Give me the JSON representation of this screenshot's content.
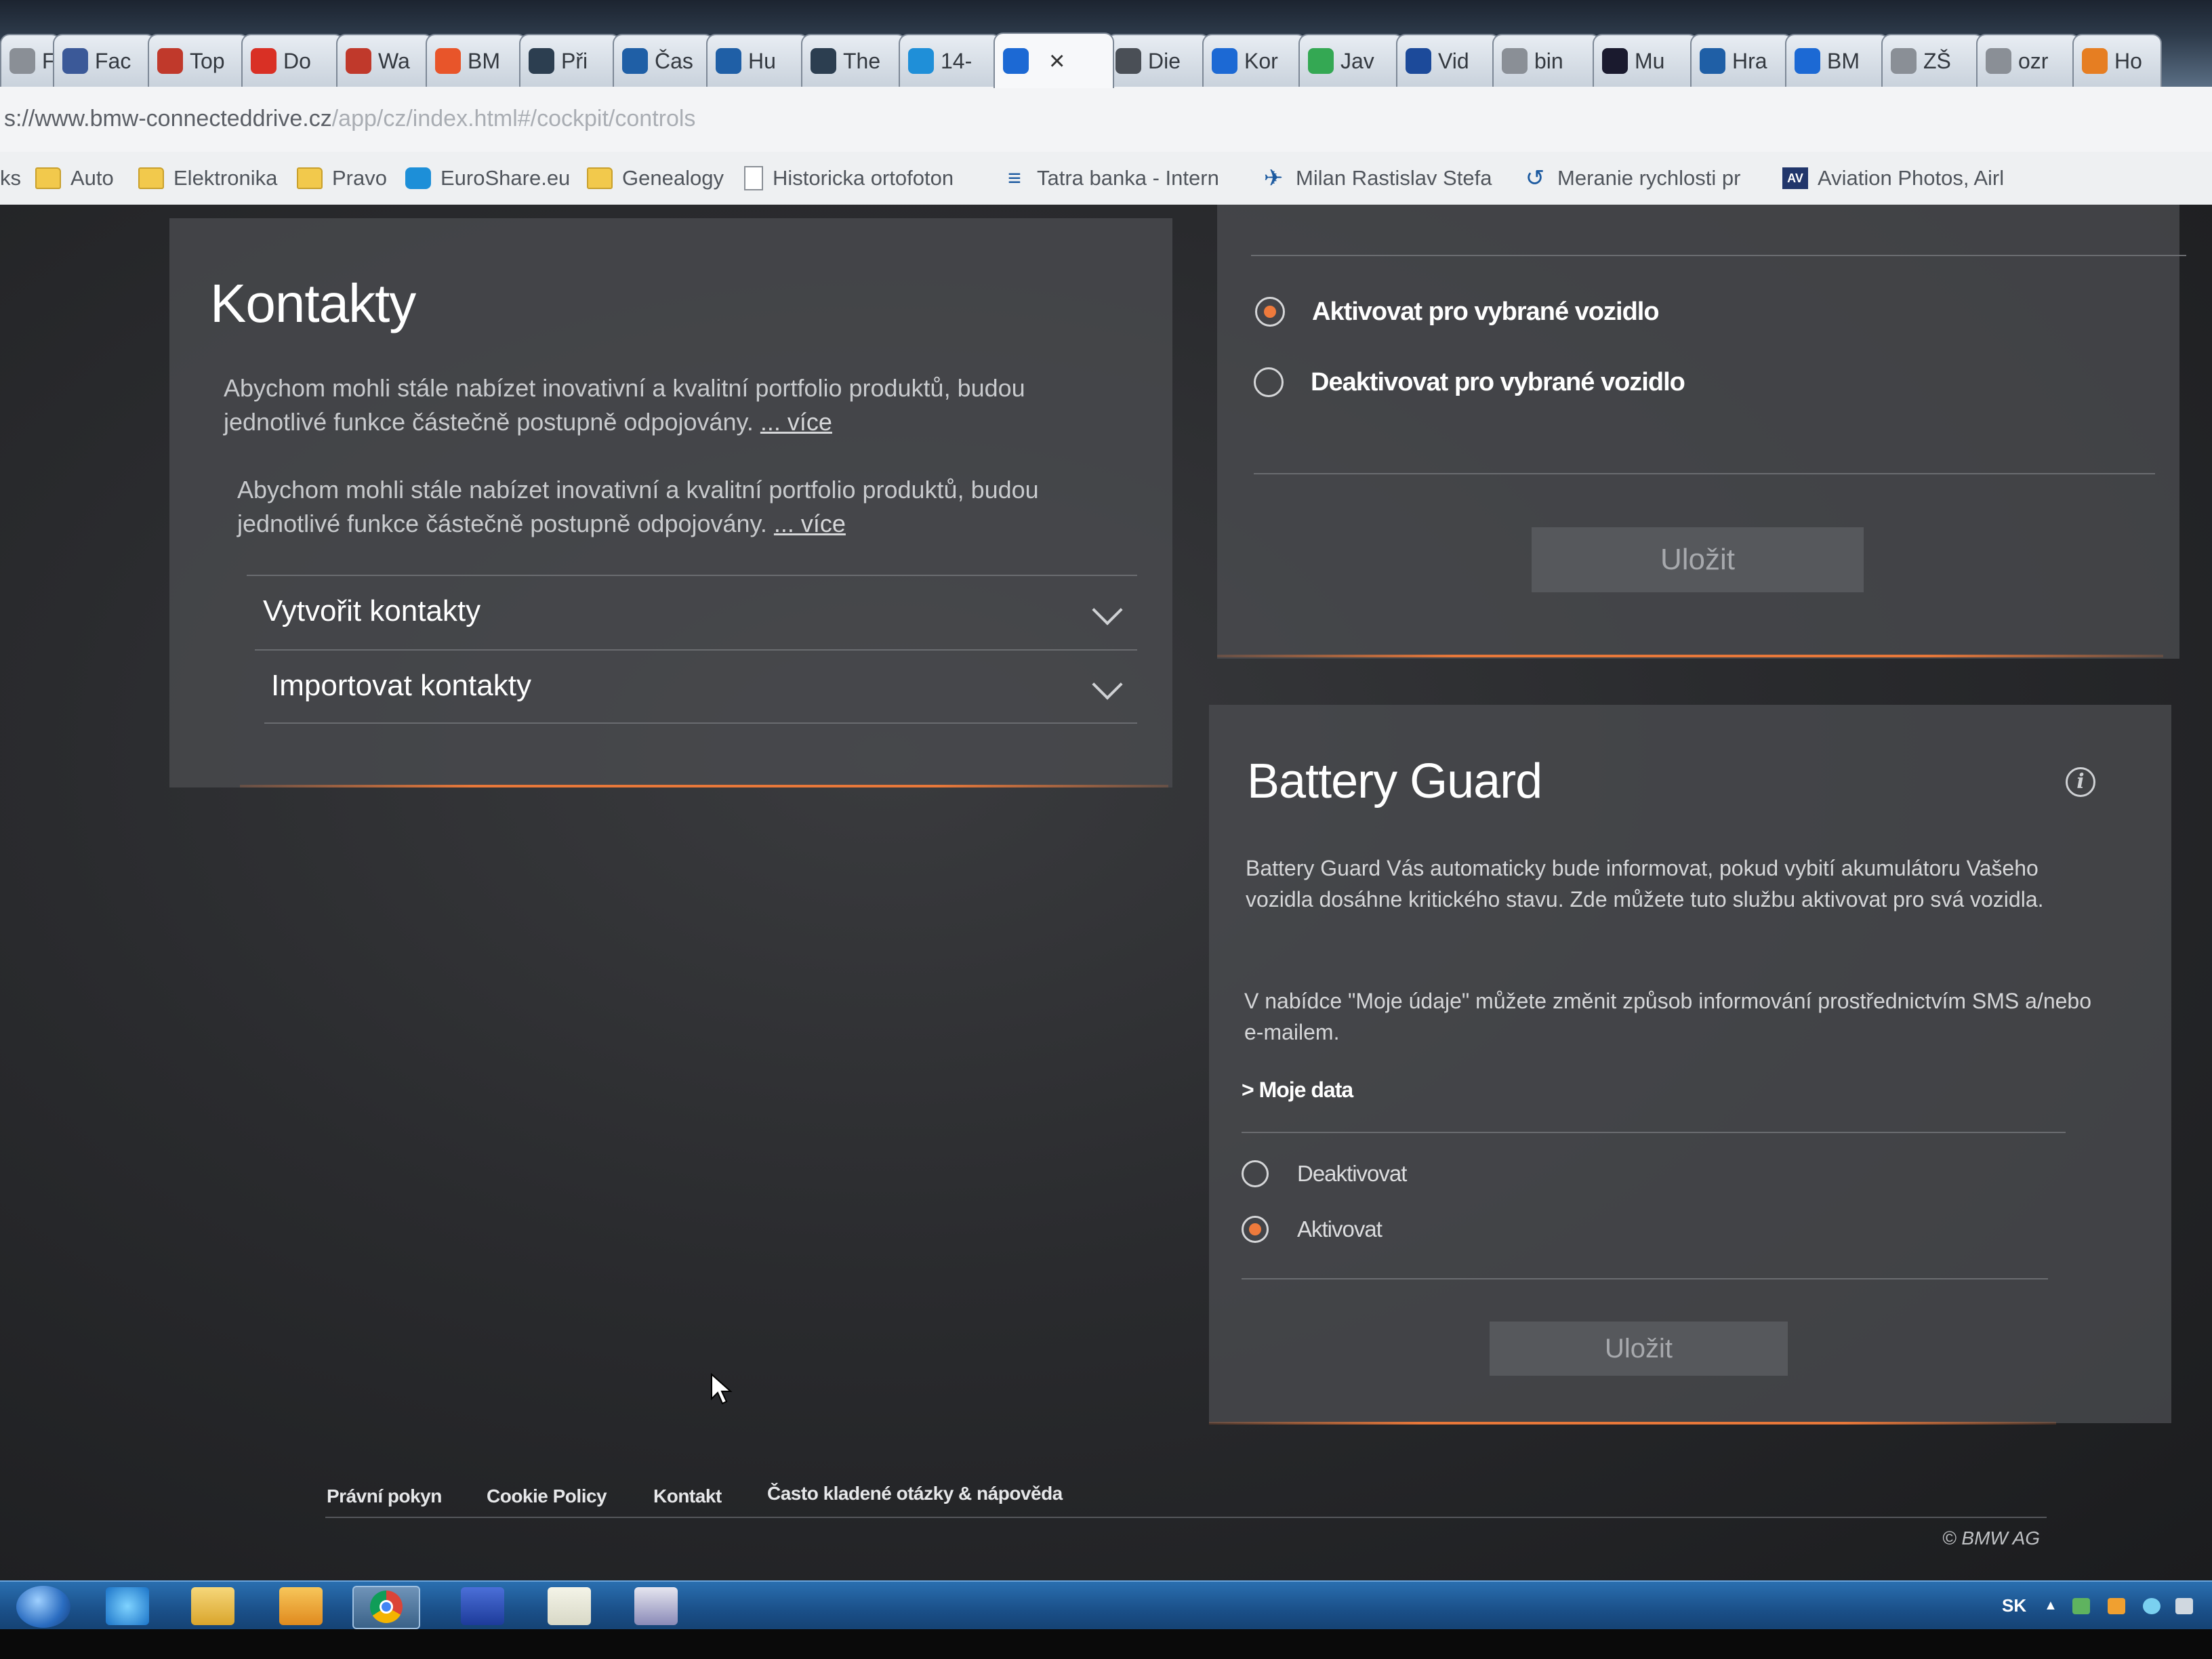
{
  "browser": {
    "tabs": [
      {
        "label": "Fer",
        "favicon": "page-icon",
        "color": "#8a8f96"
      },
      {
        "label": "Fac",
        "favicon": "facebook-icon",
        "color": "#3b5998"
      },
      {
        "label": "Top",
        "favicon": "gift-icon",
        "color": "#c0392b"
      },
      {
        "label": "Do",
        "favicon": "gmail-icon",
        "color": "#d93025"
      },
      {
        "label": "Wa",
        "favicon": "compass-icon",
        "color": "#c0392b"
      },
      {
        "label": "BM",
        "favicon": "m-icon",
        "color": "#e8552a"
      },
      {
        "label": "Při",
        "favicon": "shield-icon",
        "color": "#2c3e50"
      },
      {
        "label": "Čas",
        "favicon": "book-icon",
        "color": "#1f5fa6"
      },
      {
        "label": "Hu",
        "favicon": "book-icon",
        "color": "#1f5fa6"
      },
      {
        "label": "The",
        "favicon": "music-icon",
        "color": "#2c3e50"
      },
      {
        "label": "14-",
        "favicon": "at-icon",
        "color": "#1f8fd8"
      },
      {
        "label": "",
        "favicon": "bmw-icon",
        "color": "#1c69d4",
        "active": true
      },
      {
        "label": "Die",
        "favicon": "document-icon",
        "color": "#4a4f56"
      },
      {
        "label": "Kor",
        "favicon": "bmw-icon",
        "color": "#1c69d4"
      },
      {
        "label": "Jav",
        "favicon": "maps-icon",
        "color": "#34a853"
      },
      {
        "label": "Vid",
        "favicon": "bb-icon",
        "color": "#1c4a9a"
      },
      {
        "label": "bin",
        "favicon": "page-icon",
        "color": "#8a8f96"
      },
      {
        "label": "Mu",
        "favicon": "chart-icon",
        "color": "#1a1a2e"
      },
      {
        "label": "Hra",
        "favicon": "crest-icon",
        "color": "#1f5fa6"
      },
      {
        "label": "BM",
        "favicon": "bmw-icon",
        "color": "#1c69d4"
      },
      {
        "label": "ZŠ",
        "favicon": "page-icon",
        "color": "#8a8f96"
      },
      {
        "label": "ozr",
        "favicon": "page-icon",
        "color": "#8a8f96"
      },
      {
        "label": "Ho",
        "favicon": "hat-icon",
        "color": "#e67e22"
      }
    ],
    "url_host": "s://www.bmw-connecteddrive.cz",
    "url_path": "/app/cz/index.html#/cockpit/controls",
    "bookmarks": [
      {
        "label": "ks",
        "icon": "none"
      },
      {
        "label": "Auto",
        "icon": "folder-icon"
      },
      {
        "label": "Elektronika",
        "icon": "folder-icon"
      },
      {
        "label": "Pravo",
        "icon": "folder-icon"
      },
      {
        "label": "EuroShare.eu",
        "icon": "euroshare-icon"
      },
      {
        "label": "Genealogy",
        "icon": "folder-icon"
      },
      {
        "label": "Historicka ortofoton",
        "icon": "page-icon"
      },
      {
        "label": "Tatra banka - Intern",
        "icon": "tatra-icon"
      },
      {
        "label": "Milan Rastislav Stefa",
        "icon": "plane-icon"
      },
      {
        "label": "Meranie rychlosti pr",
        "icon": "speed-icon"
      },
      {
        "label": "Aviation Photos, Airl",
        "icon": "aviation-icon"
      }
    ]
  },
  "contacts": {
    "title": "Kontakty",
    "paragraph1": "Abychom mohli stále nabízet inovativní a kvalitní portfolio produktů, budou jednotlivé funkce částečně postupně odpojovány.",
    "paragraph2": "Abychom mohli stále nabízet inovativní a kvalitní portfolio produktů, budou jednotlivé funkce částečně postupně odpojovány.",
    "more_link": "... více",
    "accordion": [
      {
        "label": "Vytvořit kontakty"
      },
      {
        "label": "Importovat kontakty"
      }
    ]
  },
  "vehicle_activation": {
    "options": [
      {
        "label": "Aktivovat pro vybrané vozidlo",
        "selected": true
      },
      {
        "label": "Deaktivovat pro vybrané vozidlo",
        "selected": false
      }
    ],
    "save_label": "Uložit"
  },
  "battery_guard": {
    "title": "Battery Guard",
    "description1": "Battery Guard Vás automaticky bude informovat, pokud vybití akumulátoru Vašeho vozidla dosáhne kritického stavu. Zde můžete tuto službu aktivovat pro svá vozidla.",
    "description2": "V nabídce \"Moje údaje\" můžete změnit způsob informování prostřednictvím SMS a/nebo e-mailem.",
    "moje_link": "Moje data",
    "options": [
      {
        "label": "Deaktivovat",
        "selected": false
      },
      {
        "label": "Aktivovat",
        "selected": true
      }
    ],
    "save_label": "Uložit"
  },
  "footer": {
    "links": [
      "Právní pokyn",
      "Cookie Policy",
      "Kontakt",
      "Často kladené otázky & nápověda"
    ],
    "copyright": "© BMW AG"
  },
  "taskbar": {
    "language": "SK"
  },
  "colors": {
    "accent": "#e8783a",
    "panel": "#4a4c50",
    "background": "#2a2b2e"
  }
}
